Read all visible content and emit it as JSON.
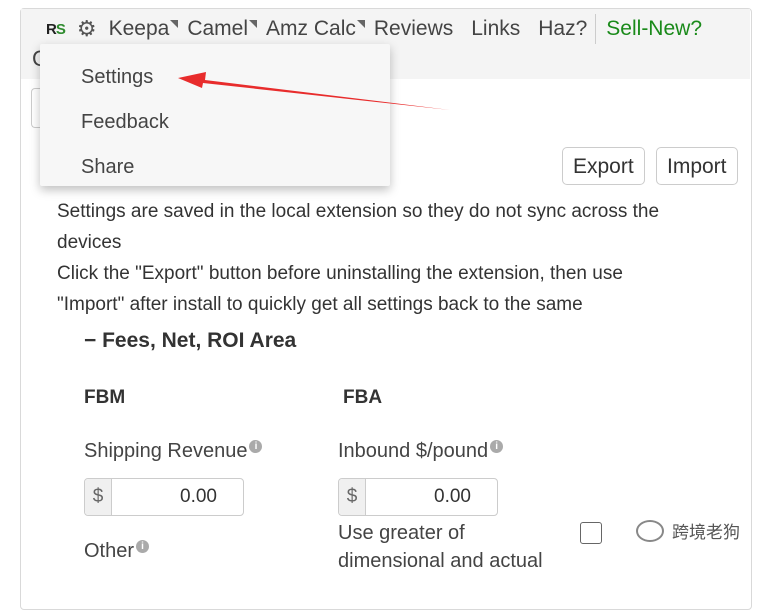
{
  "nav": {
    "logo_r": "R",
    "logo_s": "S",
    "items": [
      {
        "label": "Keepa",
        "dropdown": true
      },
      {
        "label": "Camel",
        "dropdown": true
      },
      {
        "label": "Amz Calc",
        "dropdown": true
      },
      {
        "label": "Reviews",
        "dropdown": false
      },
      {
        "label": "Links",
        "dropdown": false
      },
      {
        "label": "Haz?",
        "dropdown": false
      }
    ],
    "sell_new": "Sell-New?",
    "sell_color": "#1a8a1a"
  },
  "dropdown": {
    "items": [
      "Settings",
      "Feedback",
      "Share"
    ]
  },
  "buttons": {
    "export": "Export",
    "import": "Import"
  },
  "notice": {
    "line1": "Settings are saved in the local extension so they do not sync across the",
    "line2": "devices",
    "line3": "Click the \"Export\" button before uninstalling the extension, then use",
    "line4": "\"Import\" after install to quickly get all settings back to the same"
  },
  "section": {
    "title": "− Fees, Net, ROI Area"
  },
  "fbm": {
    "heading": "FBM",
    "shipping_label": "Shipping Revenue",
    "currency": "$",
    "shipping_value": "0.00",
    "other_label": "Other"
  },
  "fba": {
    "heading": "FBA",
    "inbound_label": "Inbound $/pound",
    "currency": "$",
    "inbound_value": "0.00",
    "greater_label_1": "Use greater of",
    "greater_label_2": "dimensional and actual"
  },
  "watermark": {
    "text": "跨境老狗"
  },
  "colors": {
    "annotation_arrow": "#e82c2c"
  }
}
